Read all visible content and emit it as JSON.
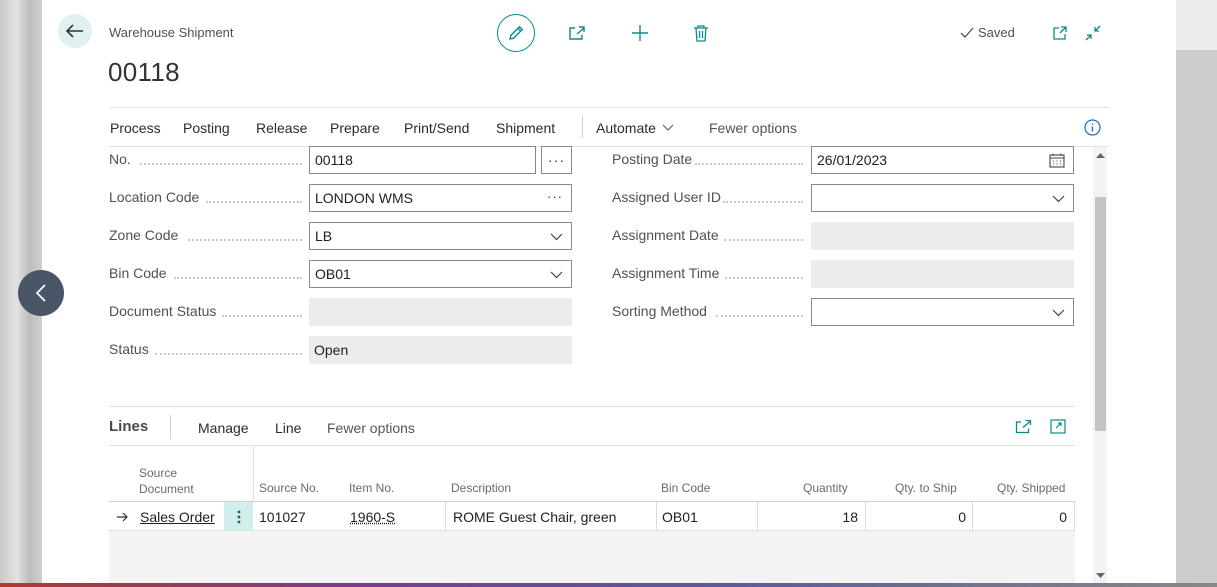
{
  "header": {
    "caption": "Warehouse Shipment",
    "title": "00118",
    "status": "Saved"
  },
  "actions": [
    "Process",
    "Posting",
    "Release",
    "Prepare",
    "Print/Send",
    "Shipment",
    "Automate",
    "Fewer options"
  ],
  "left_fields": [
    {
      "label": "No.",
      "value": "00118"
    },
    {
      "label": "Location Code",
      "value": "LONDON WMS"
    },
    {
      "label": "Zone Code",
      "value": "LB"
    },
    {
      "label": "Bin Code",
      "value": "OB01"
    },
    {
      "label": "Document Status",
      "value": ""
    },
    {
      "label": "Status",
      "value": "Open"
    }
  ],
  "right_fields": [
    {
      "label": "Posting Date",
      "value": "26/01/2023"
    },
    {
      "label": "Assigned User ID",
      "value": ""
    },
    {
      "label": "Assignment Date",
      "value": ""
    },
    {
      "label": "Assignment Time",
      "value": ""
    },
    {
      "label": "Sorting Method",
      "value": ""
    }
  ],
  "lines": {
    "title": "Lines",
    "actions": [
      "Manage",
      "Line",
      "Fewer options"
    ],
    "columns": {
      "source_document_1": "Source",
      "source_document_2": "Document",
      "source_no": "Source No.",
      "item_no": "Item No.",
      "description": "Description",
      "bin_code": "Bin Code",
      "quantity": "Quantity",
      "qty_to_ship": "Qty. to Ship",
      "qty_shipped": "Qty. Shipped"
    },
    "rows": [
      {
        "source_document": "Sales Order",
        "source_no": "101027",
        "item_no": "1960-S",
        "description": "ROME Guest Chair, green",
        "bin_code": "OB01",
        "quantity": "18",
        "qty_to_ship": "0",
        "qty_shipped": "0"
      }
    ]
  },
  "colors": {
    "accent": "#0a8a87",
    "side_nav": "#4a5668",
    "info": "#1b6ec2"
  },
  "icons": {
    "back": "arrow-left-icon",
    "edit": "pencil-icon",
    "share": "share-icon",
    "new": "plus-icon",
    "delete": "trash-icon",
    "saved": "checkmark-icon",
    "open_new": "open-in-new-window-icon",
    "collapse": "collapse-icon",
    "info": "info-icon",
    "calendar": "calendar-icon"
  }
}
